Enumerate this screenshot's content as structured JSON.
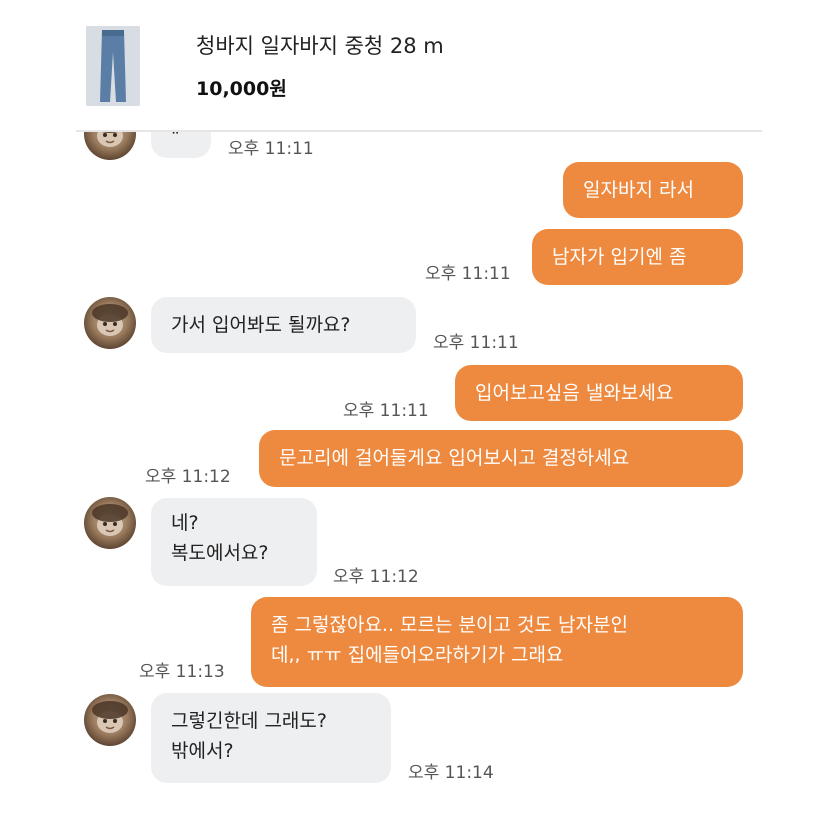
{
  "listing": {
    "title": "청바지 일자바지 중청 28 m",
    "price": "10,000원"
  },
  "messages": [
    {
      "side": "in",
      "text": "\"",
      "time": "오후 11:11"
    },
    {
      "side": "out",
      "text": "일자바지 라서"
    },
    {
      "side": "out",
      "text": "남자가 입기엔 좀",
      "time": "오후 11:11"
    },
    {
      "side": "in",
      "text": "가서 입어봐도 될까요?",
      "time": "오후 11:11"
    },
    {
      "side": "out",
      "text": "입어보고싶음 낼와보세요",
      "time": "오후 11:11"
    },
    {
      "side": "out",
      "text": "문고리에 걸어둘게요 입어보시고 결정하세요",
      "time": "오후 11:12"
    },
    {
      "side": "in",
      "lines": [
        "네?",
        "복도에서요?"
      ],
      "time": "오후 11:12"
    },
    {
      "side": "out",
      "lines": [
        "좀 그렇잖아요.. 모르는 분이고 것도 남자분인",
        "데,, ㅠㅠ 집에들어오라하기가 그래요"
      ],
      "time": "오후 11:13"
    },
    {
      "side": "in",
      "lines": [
        "그렇긴한데 그래도?",
        "밖에서?"
      ],
      "time": "오후 11:14"
    }
  ],
  "colors": {
    "outgoing_bubble": "#ee8a3f",
    "incoming_bubble": "#eeeff1"
  },
  "icons": {
    "avatar": "profile-photo"
  }
}
